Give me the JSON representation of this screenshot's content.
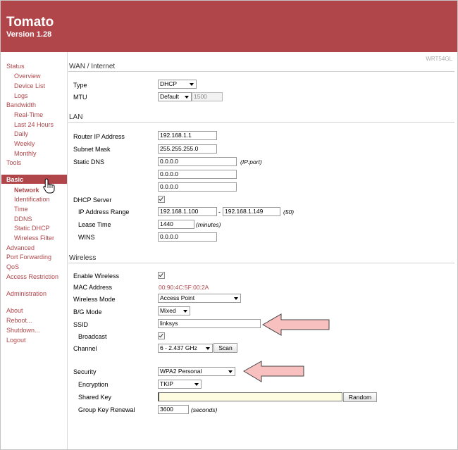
{
  "header": {
    "title": "Tomato",
    "version": "Version 1.28"
  },
  "router_model": "WRT54GL",
  "sidebar": {
    "status": "Status",
    "status_items": [
      "Overview",
      "Device List",
      "Logs"
    ],
    "bandwidth": "Bandwidth",
    "bandwidth_items": [
      "Real-Time",
      "Last 24 Hours",
      "Daily",
      "Weekly",
      "Monthly"
    ],
    "tools": "Tools",
    "basic": "Basic",
    "basic_items": [
      "Network",
      "Identification",
      "Time",
      "DDNS",
      "Static DHCP",
      "Wireless Filter"
    ],
    "advanced": "Advanced",
    "port_forwarding": "Port Forwarding",
    "qos": "QoS",
    "access_restriction": "Access Restriction",
    "administration": "Administration",
    "about": "About",
    "reboot": "Reboot...",
    "shutdown": "Shutdown...",
    "logout": "Logout"
  },
  "wan": {
    "heading": "WAN / Internet",
    "type_label": "Type",
    "type_value": "DHCP",
    "mtu_label": "MTU",
    "mtu_mode": "Default",
    "mtu_value": "1500"
  },
  "lan": {
    "heading": "LAN",
    "router_ip_label": "Router IP Address",
    "router_ip": "192.168.1.1",
    "subnet_label": "Subnet Mask",
    "subnet": "255.255.255.0",
    "dns_label": "Static DNS",
    "dns": [
      "0.0.0.0",
      "0.0.0.0",
      "0.0.0.0"
    ],
    "dns_hint": "(IP:port)",
    "dhcp_label": "DHCP Server",
    "range_label": "IP Address Range",
    "range_start": "192.168.1.100",
    "range_dash": "-",
    "range_end": "192.168.1.149",
    "range_count": "(50)",
    "lease_label": "Lease Time",
    "lease": "1440",
    "lease_hint": "(minutes)",
    "wins_label": "WINS",
    "wins": "0.0.0.0"
  },
  "wireless": {
    "heading": "Wireless",
    "enable_label": "Enable Wireless",
    "mac_label": "MAC Address",
    "mac": "00:90:4C:5F:00:2A",
    "mode_label": "Wireless Mode",
    "mode": "Access Point",
    "bg_label": "B/G Mode",
    "bg": "Mixed",
    "ssid_label": "SSID",
    "ssid": "linksys",
    "broadcast_label": "Broadcast",
    "channel_label": "Channel",
    "channel": "6 - 2.437 GHz",
    "scan": "Scan",
    "security_label": "Security",
    "security": "WPA2 Personal",
    "encryption_label": "Encryption",
    "encryption": "TKIP",
    "shared_key_label": "Shared Key",
    "shared_key": "",
    "random": "Random",
    "renewal_label": "Group Key Renewal",
    "renewal": "3600",
    "renewal_hint": "(seconds)"
  },
  "colors": {
    "accent": "#b0464a",
    "arrow_fill": "#f9c0c0",
    "field_highlight": "#fdfce0"
  }
}
